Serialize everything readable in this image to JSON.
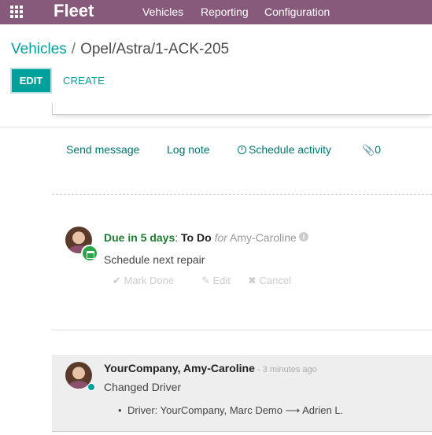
{
  "navbar": {
    "app_name": "Fleet",
    "menus": [
      "Vehicles",
      "Reporting",
      "Configuration"
    ],
    "color": "#875A7B"
  },
  "breadcrumb": {
    "parent": "Vehicles",
    "separator": "/",
    "current": "Opel/Astra/1-ACK-205"
  },
  "buttons": {
    "edit": "EDIT",
    "create": "CREATE"
  },
  "chatter": {
    "send_message": "Send message",
    "log_note": "Log note",
    "schedule_activity": "Schedule activity",
    "attachments_count": "0"
  },
  "activity": {
    "due": "Due in 5 days",
    "colon": ":",
    "type": "To Do",
    "for_label": "for",
    "assignee": "Amy-Caroline",
    "summary": "Schedule next repair",
    "mark_done": "✔ Mark Done",
    "edit": "✎ Edit",
    "cancel": "✖ Cancel"
  },
  "message": {
    "author": "YourCompany, Amy-Caroline",
    "time": " - 3 minutes ago",
    "body": "Changed Driver",
    "change": "Driver: YourCompany, Marc Demo ⟶ Adrien L."
  },
  "colors": {
    "accent": "#00A09D",
    "due": "#28a745"
  },
  "icons": [
    "apps-grid-icon",
    "clock-icon",
    "paperclip-icon",
    "info-icon",
    "activity-type-icon",
    "check-icon",
    "pencil-icon",
    "times-icon"
  ]
}
